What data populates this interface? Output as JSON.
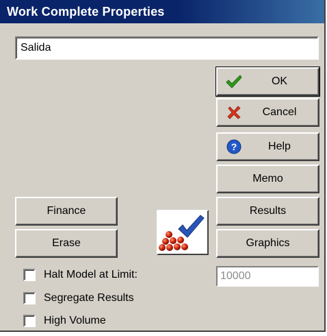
{
  "window": {
    "title": "Work Complete Properties"
  },
  "name_field": {
    "value": "Salida"
  },
  "buttons": {
    "ok": "OK",
    "cancel": "Cancel",
    "help": "Help",
    "memo": "Memo",
    "results": "Results",
    "graphics": "Graphics",
    "finance": "Finance",
    "erase": "Erase"
  },
  "options": {
    "halt_model": {
      "label": "Halt Model at Limit:",
      "checked": false
    },
    "segregate": {
      "label": "Segregate Results",
      "checked": false
    },
    "high_volume": {
      "label": "High Volume",
      "checked": false
    }
  },
  "limit_field": {
    "value": "10000",
    "disabled": true
  },
  "colors": {
    "titlebar": "#0a246a",
    "dialog_bg": "#d4d0c8",
    "ok_check": "#2e9b18",
    "cancel_x": "#d8361d",
    "help_icon": "#2358c8"
  },
  "icons": {
    "ok": "green-checkmark-icon",
    "cancel": "red-x-icon",
    "help": "blue-question-icon",
    "logo": "stacked-balls-checkmark-icon"
  }
}
